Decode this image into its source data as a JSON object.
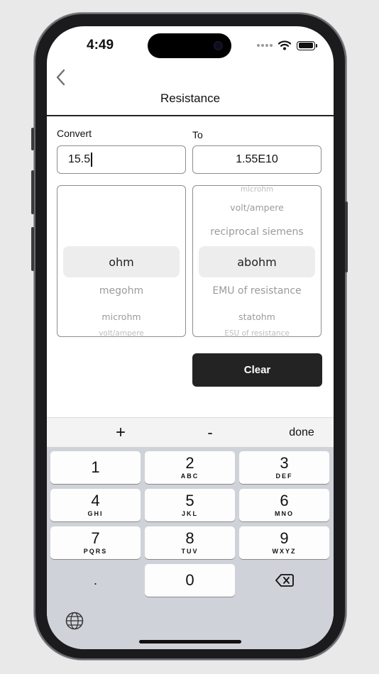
{
  "status_bar": {
    "time": "4:49"
  },
  "nav": {
    "title": "Resistance"
  },
  "convert": {
    "from_label": "Convert",
    "to_label": "To",
    "from_value": "15.5",
    "to_value": "1.55E10"
  },
  "from_picker": {
    "items": [
      "ohm",
      "megohm",
      "microhm",
      "volt/ampere"
    ],
    "selected": "ohm"
  },
  "to_picker": {
    "items_above": [
      "microhm",
      "volt/ampere",
      "reciprocal siemens"
    ],
    "selected": "abohm",
    "items_below": [
      "EMU of resistance",
      "statohm",
      "ESU of resistance"
    ]
  },
  "actions": {
    "clear_label": "Clear"
  },
  "keyboard_toolbar": {
    "plus": "+",
    "minus": "-",
    "done": "done"
  },
  "keypad": {
    "keys": [
      {
        "num": "1",
        "letters": ""
      },
      {
        "num": "2",
        "letters": "ABC"
      },
      {
        "num": "3",
        "letters": "DEF"
      },
      {
        "num": "4",
        "letters": "GHI"
      },
      {
        "num": "5",
        "letters": "JKL"
      },
      {
        "num": "6",
        "letters": "MNO"
      },
      {
        "num": "7",
        "letters": "PQRS"
      },
      {
        "num": "8",
        "letters": "TUV"
      },
      {
        "num": "9",
        "letters": "WXYZ"
      },
      {
        "num": ".",
        "letters": ""
      },
      {
        "num": "0",
        "letters": ""
      }
    ],
    "delete_icon": "backspace-icon",
    "globe_icon": "globe-icon"
  }
}
